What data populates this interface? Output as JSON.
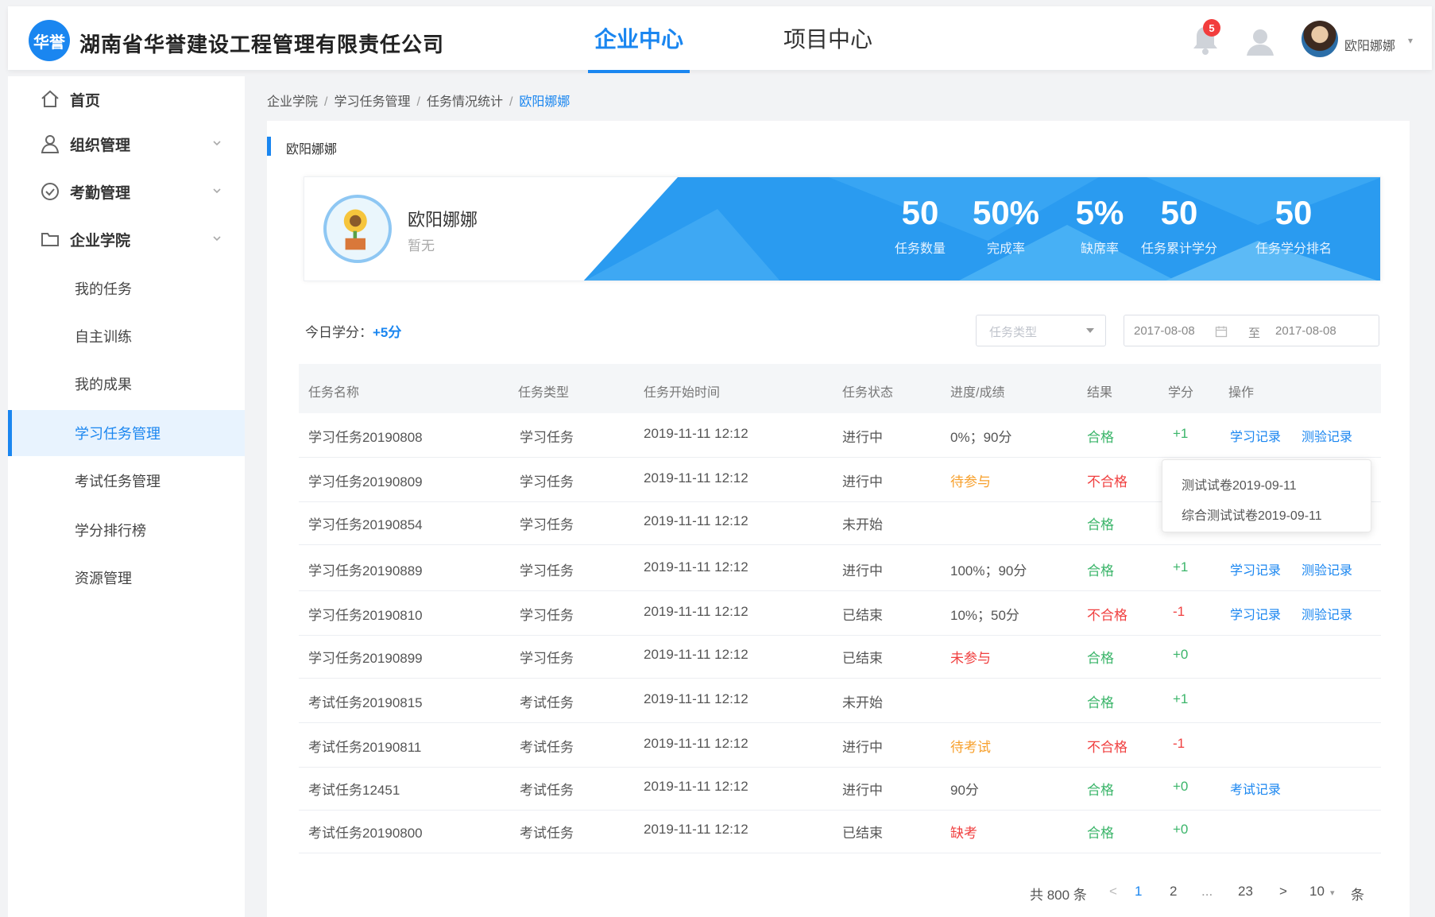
{
  "header": {
    "logo_text": "华誉",
    "company": "湖南省华誉建设工程管理有限责任公司",
    "tabs": [
      {
        "label": "企业中心",
        "active": true
      },
      {
        "label": "项目中心",
        "active": false
      }
    ],
    "notification_count": "5",
    "user_name": "欧阳娜娜",
    "brand_color": "#1a86f0"
  },
  "sidebar": {
    "items": [
      {
        "label": "首页",
        "icon": "home-icon"
      },
      {
        "label": "组织管理",
        "icon": "user-icon"
      },
      {
        "label": "考勤管理",
        "icon": "check-circle-icon"
      },
      {
        "label": "企业学院",
        "icon": "folder-icon"
      }
    ],
    "sub_items": [
      {
        "label": "我的任务"
      },
      {
        "label": "自主训练"
      },
      {
        "label": "我的成果"
      },
      {
        "label": "学习任务管理",
        "active": true
      },
      {
        "label": "考试任务管理"
      },
      {
        "label": "学分排行榜"
      },
      {
        "label": "资源管理"
      }
    ]
  },
  "breadcrumb": [
    "企业学院",
    "学习任务管理",
    "任务情况统计",
    "欧阳娜娜"
  ],
  "card_title": "欧阳娜娜",
  "profile": {
    "name": "欧阳娜娜",
    "subtitle": "暂无",
    "stats": [
      {
        "value": "50",
        "label": "任务数量"
      },
      {
        "value": "50%",
        "label": "完成率"
      },
      {
        "value": "5%",
        "label": "缺席率"
      },
      {
        "value": "50",
        "label": "任务累计学分"
      },
      {
        "value": "50",
        "label": "任务学分排名"
      }
    ]
  },
  "filters": {
    "today_label": "今日学分：",
    "today_points": "+5分",
    "type_placeholder": "任务类型",
    "date_start": "2017-08-08",
    "date_sep": "至",
    "date_end": "2017-08-08"
  },
  "table": {
    "columns": [
      "任务名称",
      "任务类型",
      "任务开始时间",
      "任务状态",
      "进度/成绩",
      "结果",
      "学分",
      "操作"
    ],
    "rows": [
      {
        "name": "学习任务20190808",
        "type": "学习任务",
        "time": "2019-11-11  12:12",
        "status": "进行中",
        "progress": "0%；90分",
        "progress_color": "normal",
        "result": "合格",
        "result_color": "green",
        "credit": "+1",
        "credit_color": "green",
        "actions": [
          "学习记录",
          "测验记录"
        ]
      },
      {
        "name": "学习任务20190809",
        "type": "学习任务",
        "time": "2019-11-11  12:12",
        "status": "进行中",
        "progress": "待参与",
        "progress_color": "orange",
        "result": "不合格",
        "result_color": "red",
        "credit": "",
        "credit_color": "green",
        "actions": []
      },
      {
        "name": "学习任务20190854",
        "type": "学习任务",
        "time": "2019-11-11  12:12",
        "status": "未开始",
        "progress": "",
        "progress_color": "normal",
        "result": "合格",
        "result_color": "green",
        "credit": "",
        "credit_color": "green",
        "actions": []
      },
      {
        "name": "学习任务20190889",
        "type": "学习任务",
        "time": "2019-11-11  12:12",
        "status": "进行中",
        "progress": "100%；90分",
        "progress_color": "normal",
        "result": "合格",
        "result_color": "green",
        "credit": "+1",
        "credit_color": "green",
        "actions": [
          "学习记录",
          "测验记录"
        ]
      },
      {
        "name": "学习任务20190810",
        "type": "学习任务",
        "time": "2019-11-11  12:12",
        "status": "已结束",
        "progress": "10%；50分",
        "progress_color": "normal",
        "result": "不合格",
        "result_color": "red",
        "credit": "-1",
        "credit_color": "red",
        "actions": [
          "学习记录",
          "测验记录"
        ]
      },
      {
        "name": "学习任务20190899",
        "type": "学习任务",
        "time": "2019-11-11  12:12",
        "status": "已结束",
        "progress": "未参与",
        "progress_color": "red",
        "result": "合格",
        "result_color": "green",
        "credit": "+0",
        "credit_color": "green",
        "actions": []
      },
      {
        "name": "考试任务20190815",
        "type": "考试任务",
        "time": "2019-11-11  12:12",
        "status": "未开始",
        "progress": "",
        "progress_color": "normal",
        "result": "合格",
        "result_color": "green",
        "credit": "+1",
        "credit_color": "green",
        "actions": []
      },
      {
        "name": "考试任务20190811",
        "type": "考试任务",
        "time": "2019-11-11  12:12",
        "status": "进行中",
        "progress": "待考试",
        "progress_color": "orange",
        "result": "不合格",
        "result_color": "red",
        "credit": "-1",
        "credit_color": "red",
        "actions": []
      },
      {
        "name": "考试任务12451",
        "type": "考试任务",
        "time": "2019-11-11  12:12",
        "status": "进行中",
        "progress": "90分",
        "progress_color": "normal",
        "result": "合格",
        "result_color": "green",
        "credit": "+0",
        "credit_color": "green",
        "actions": [
          "考试记录"
        ]
      },
      {
        "name": "考试任务20190800",
        "type": "考试任务",
        "time": "2019-11-11  12:12",
        "status": "已结束",
        "progress": "缺考",
        "progress_color": "red",
        "result": "合格",
        "result_color": "green",
        "credit": "+0",
        "credit_color": "green",
        "actions": []
      }
    ]
  },
  "popover": {
    "options": [
      "测试试卷2019-09-11",
      "综合测试试卷2019-09-11"
    ]
  },
  "pagination": {
    "total": "共 800 条",
    "pages": [
      "1",
      "2",
      "...",
      "23"
    ],
    "current": "1",
    "page_size": "10",
    "page_size_unit": "条"
  }
}
